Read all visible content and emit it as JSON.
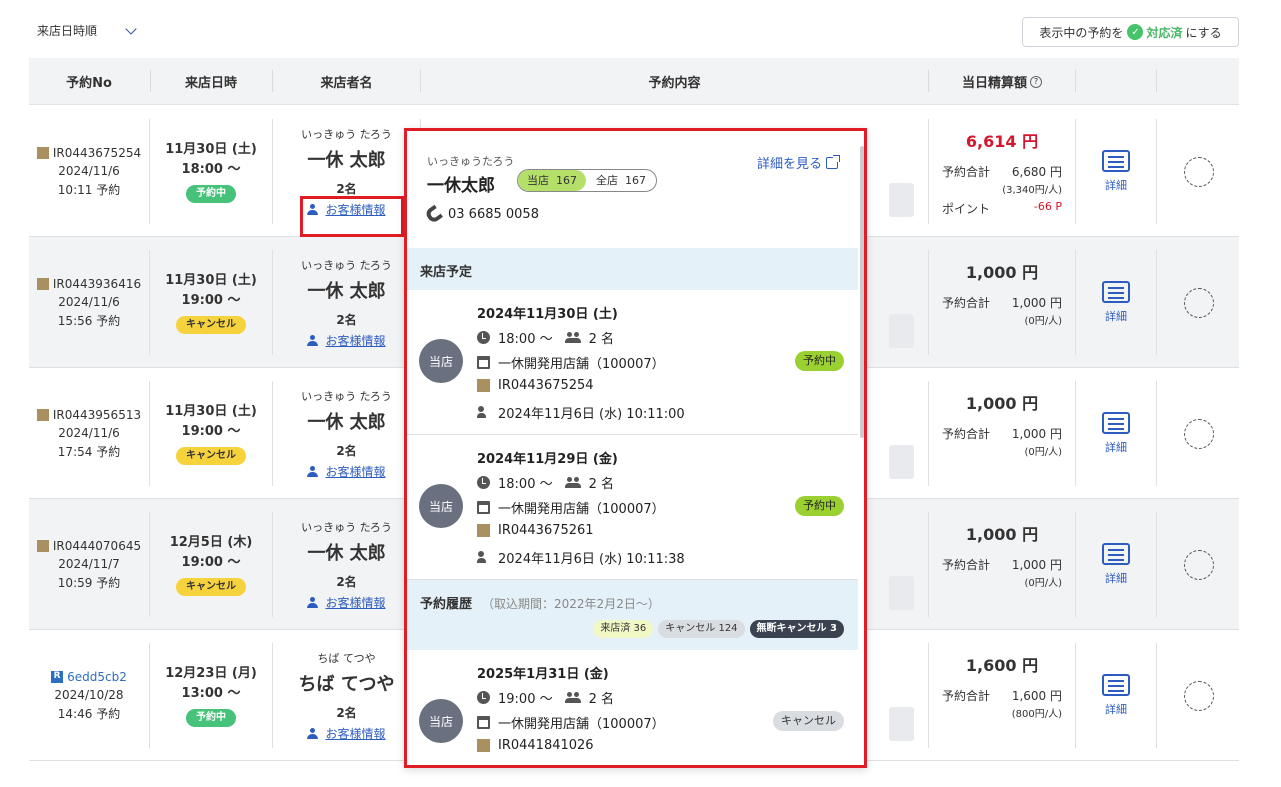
{
  "toolbar": {
    "sort_label": "来店日時順",
    "mark_prefix": "表示中の予約を",
    "mark_status": "対応済",
    "mark_suffix": "にする"
  },
  "table": {
    "headers": {
      "no": "予約No",
      "datetime": "来店日時",
      "name": "来店者名",
      "content": "予約内容",
      "amount": "当日精算額",
      "amount_help": "?"
    },
    "rows": [
      {
        "id": "IR0443675254",
        "source": "ikyu",
        "made_date": "2024/11/6",
        "made_time": "10:11 予約",
        "date": "11月30日 (土)",
        "time": "18:00 〜",
        "status": "予約中",
        "status_type": "ok",
        "kana": "いっきゅう たろう",
        "name": "一休 太郎",
        "count": "2名",
        "customer_link": "お客様情報",
        "amount": "6,614 円",
        "amount_red": true,
        "lines": [
          {
            "label": "予約合計",
            "value": "6,680 円",
            "sub": "(3,340円/人)"
          },
          {
            "label": "ポイント",
            "value": "-66 P",
            "red": true
          }
        ],
        "detail": "詳細"
      },
      {
        "id": "IR0443936416",
        "source": "ikyu",
        "made_date": "2024/11/6",
        "made_time": "15:56 予約",
        "date": "11月30日 (土)",
        "time": "19:00 〜",
        "status": "キャンセル",
        "status_type": "cancel",
        "kana": "いっきゅう たろう",
        "name": "一休 太郎",
        "count": "2名",
        "customer_link": "お客様情報",
        "amount": "1,000 円",
        "amount_red": false,
        "lines": [
          {
            "label": "予約合計",
            "value": "1,000 円",
            "sub": "(0円/人)"
          }
        ],
        "detail": "詳細"
      },
      {
        "id": "IR0443956513",
        "source": "ikyu",
        "made_date": "2024/11/6",
        "made_time": "17:54 予約",
        "date": "11月30日 (土)",
        "time": "19:00 〜",
        "status": "キャンセル",
        "status_type": "cancel",
        "kana": "いっきゅう たろう",
        "name": "一休 太郎",
        "count": "2名",
        "customer_link": "お客様情報",
        "amount": "1,000 円",
        "amount_red": false,
        "lines": [
          {
            "label": "予約合計",
            "value": "1,000 円",
            "sub": "(0円/人)"
          }
        ],
        "detail": "詳細"
      },
      {
        "id": "IR0444070645",
        "source": "ikyu",
        "made_date": "2024/11/7",
        "made_time": "10:59 予約",
        "date": "12月5日 (木)",
        "time": "19:00 〜",
        "status": "キャンセル",
        "status_type": "cancel",
        "kana": "いっきゅう たろう",
        "name": "一休 太郎",
        "count": "2名",
        "customer_link": "お客様情報",
        "amount": "1,000 円",
        "amount_red": false,
        "lines": [
          {
            "label": "予約合計",
            "value": "1,000 円",
            "sub": "(0円/人)"
          }
        ],
        "detail": "詳細"
      },
      {
        "id": "6edd5cb2",
        "source": "r",
        "source_label": "R",
        "made_date": "2024/10/28",
        "made_time": "14:46 予約",
        "date": "12月23日 (月)",
        "time": "13:00 〜",
        "status": "予約中",
        "status_type": "ok",
        "kana": "ちば てつや",
        "name": "ちば てつや",
        "count": "2名",
        "customer_link": "お客様情報",
        "amount": "1,600 円",
        "amount_red": false,
        "lines": [
          {
            "label": "予約合計",
            "value": "1,600 円",
            "sub": "(800円/人)"
          }
        ],
        "detail": "詳細"
      }
    ]
  },
  "popup": {
    "kana": "いっきゅうたろう",
    "name": "一休太郎",
    "visits_this_label": "当店",
    "visits_this": "167",
    "visits_all_label": "全店",
    "visits_all": "167",
    "detail_link": "詳細を見る",
    "phone": "03 6685 0058",
    "upcoming_title": "来店予定",
    "upcoming": [
      {
        "badge": "当店",
        "date": "2024年11月30日 (土)",
        "time": "18:00 〜",
        "people": "2 名",
        "shop": "一休開発用店舗（100007）",
        "id": "IR0443675254",
        "booked": "2024年11月6日 (水) 10:11:00",
        "status": "予約中"
      },
      {
        "badge": "当店",
        "date": "2024年11月29日 (金)",
        "time": "18:00 〜",
        "people": "2 名",
        "shop": "一休開発用店舗（100007）",
        "id": "IR0443675261",
        "booked": "2024年11月6日 (水) 10:11:38",
        "status": "予約中"
      }
    ],
    "history_title": "予約履歴",
    "history_note": "（取込期間：2022年2月2日〜）",
    "history_tags": {
      "visited": "来店済 36",
      "cancel": "キャンセル 124",
      "noshow": "無断キャンセル 3"
    },
    "history": [
      {
        "badge": "当店",
        "date": "2025年1月31日 (金)",
        "time": "19:00 〜",
        "people": "2 名",
        "shop": "一休開発用店舗（100007）",
        "id": "IR0441841026",
        "status": "キャンセル"
      }
    ]
  },
  "colors": {
    "accent": "#2d5cc0",
    "highlight": "#e01c24",
    "ok": "#47c27a",
    "cancel": "#f6d23c",
    "amount_red": "#d4172f"
  }
}
